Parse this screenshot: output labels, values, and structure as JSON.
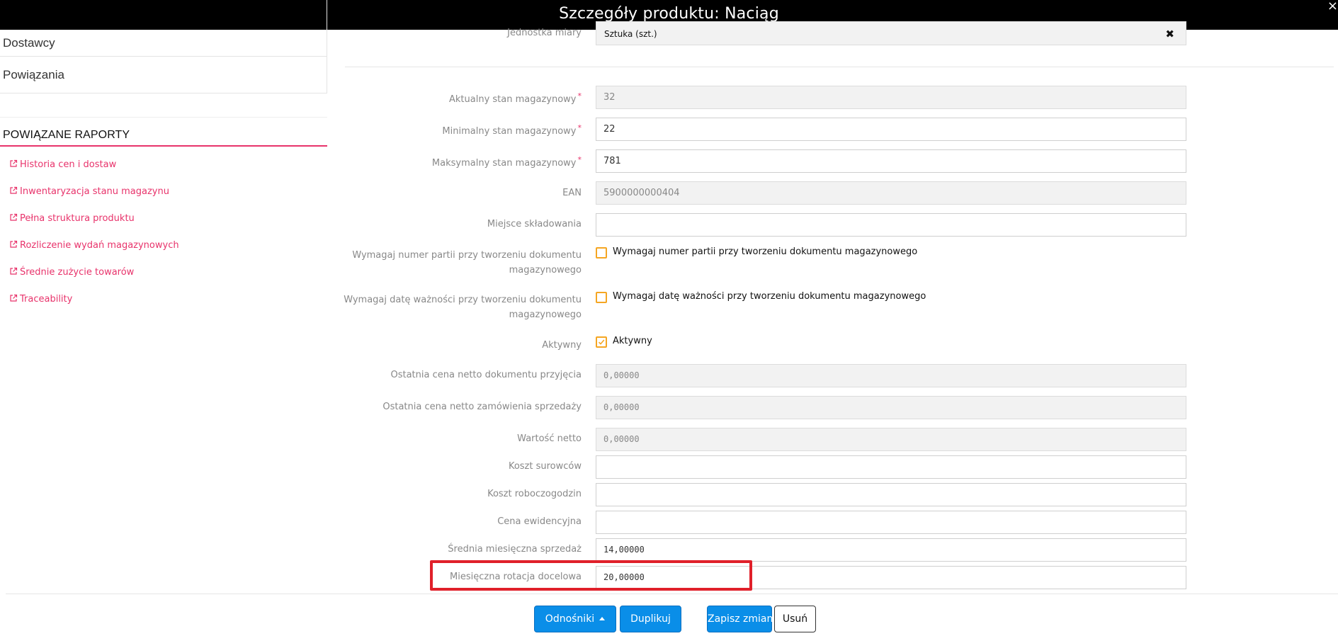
{
  "window": {
    "title": "Szczegóły produktu: Naciąg",
    "close_glyph": "×"
  },
  "sidebar": {
    "items": [
      {
        "label": "Dostawcy"
      },
      {
        "label": "Powiązania"
      }
    ],
    "reports_title": "POWIĄZANE RAPORTY",
    "report_links": [
      {
        "label": "Historia cen i dostaw",
        "icon": "external-link-icon"
      },
      {
        "label": "Inwentaryzacja stanu magazynu",
        "icon": "external-link-icon"
      },
      {
        "label": "Pełna struktura produktu",
        "icon": "external-link-icon"
      },
      {
        "label": "Rozliczenie wydań magazynowych",
        "icon": "external-link-icon"
      },
      {
        "label": "Średnie zużycie towarów",
        "icon": "external-link-icon"
      },
      {
        "label": "Traceability",
        "icon": "external-link-icon"
      }
    ]
  },
  "form": {
    "unit": {
      "label": "Jednostka miary",
      "value": "Sztuka (szt.)"
    },
    "current_stock": {
      "label": "Aktualny stan magazynowy",
      "value": "32"
    },
    "min_stock": {
      "label": "Minimalny stan magazynowy",
      "value": "22"
    },
    "max_stock": {
      "label": "Maksymalny stan magazynowy",
      "value": "781"
    },
    "ean": {
      "label": "EAN",
      "value": "5900000000404"
    },
    "storage": {
      "label": "Miejsce składowania",
      "value": ""
    },
    "require_batch": {
      "label": "Wymagaj numer partii przy tworzeniu dokumentu magazynowego",
      "checkbox_label": "Wymagaj numer partii przy tworzeniu dokumentu magazynowego",
      "checked": false
    },
    "require_expiry": {
      "label": "Wymagaj datę ważności przy tworzeniu dokumentu magazynowego",
      "checkbox_label": "Wymagaj datę ważności przy tworzeniu dokumentu magazynowego",
      "checked": false
    },
    "active": {
      "label": "Aktywny",
      "checkbox_label": "Aktywny",
      "checked": true
    },
    "last_receipt_price": {
      "label": "Ostatnia cena netto dokumentu przyjęcia",
      "value": "0,00000"
    },
    "last_order_price": {
      "label": "Ostatnia cena netto zamówienia sprzedaży",
      "value": "0,00000"
    },
    "net_value": {
      "label": "Wartość netto",
      "value": "0,00000"
    },
    "material_cost": {
      "label": "Koszt surowców",
      "value": ""
    },
    "labor_cost": {
      "label": "Koszt roboczogodzin",
      "value": ""
    },
    "book_price": {
      "label": "Cena ewidencyjna",
      "value": ""
    },
    "avg_monthly_sales": {
      "label": "Średnia miesięczna sprzedaż",
      "value": "14,00000"
    },
    "target_monthly_rotation": {
      "label": "Miesięczna rotacja docelowa",
      "value": "20,00000"
    }
  },
  "footer": {
    "links_label": "Odnośniki",
    "duplicate_label": "Duplikuj",
    "save_label": "Zapisz zmiany",
    "delete_label": "Usuń"
  },
  "colors": {
    "accent": "#e8336b",
    "primary": "#0a8ee8",
    "checkbox": "#f5a623",
    "highlight": "#e0202a"
  }
}
